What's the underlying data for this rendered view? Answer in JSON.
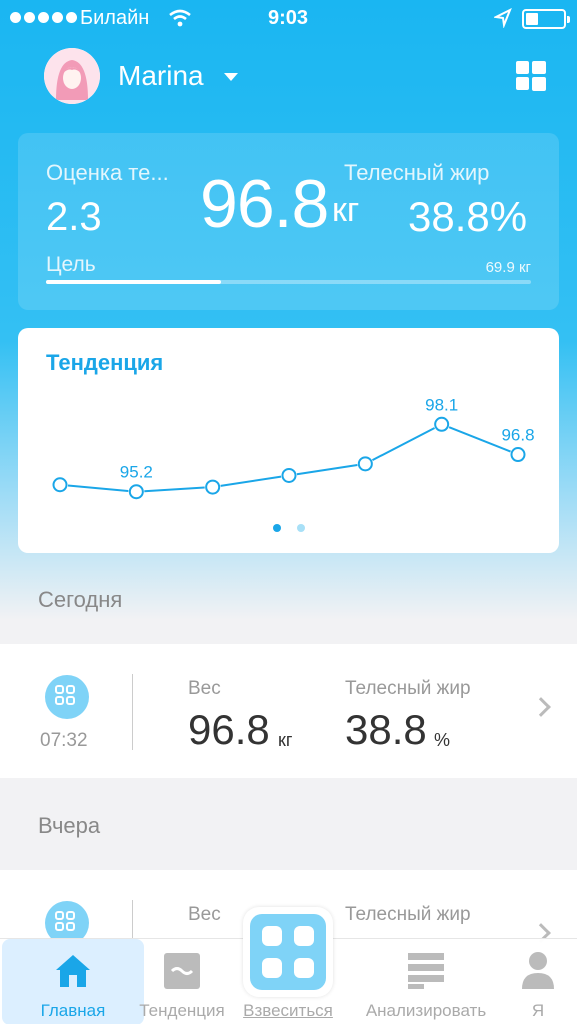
{
  "status_bar": {
    "carrier": "Билайн",
    "time": "9:03"
  },
  "header": {
    "user_name": "Marina"
  },
  "summary": {
    "score_label": "Оценка те...",
    "score_value": "2.3",
    "weight_value": "96.8",
    "weight_unit": "кг",
    "fat_label": "Телесный жир",
    "fat_value": "38.8%",
    "goal_label": "Цель",
    "goal_value": "69.9 кг",
    "goal_progress": 0.36
  },
  "trend": {
    "title": "Тенденция",
    "page_count": 2,
    "active_page": 0,
    "colors": {
      "line": "#1aa6e8",
      "dot_active": "#1aa6e8",
      "dot_inactive": "#a8e0f7"
    }
  },
  "chart_data": {
    "type": "line",
    "x": [
      1,
      2,
      3,
      4,
      5,
      6,
      7
    ],
    "series": [
      {
        "values": [
          95.5,
          95.2,
          95.4,
          95.9,
          96.4,
          98.1,
          96.8
        ]
      }
    ],
    "point_labels": [
      "",
      "95.2",
      "",
      "",
      "",
      "98.1",
      "96.8"
    ],
    "ylim": [
      94.5,
      98.8
    ],
    "grid": false
  },
  "today": {
    "section_title": "Сегодня",
    "time": "07:32",
    "weight_label": "Вес",
    "weight_value": "96.8",
    "weight_unit": "кг",
    "fat_label": "Телесный жир",
    "fat_value": "38.8",
    "fat_unit": "%"
  },
  "yesterday": {
    "section_title": "Вчера",
    "weight_label": "Вес",
    "fat_label": "Телесный жир"
  },
  "tabs": {
    "home": "Главная",
    "trend": "Тенденция",
    "weigh": "Взвеситься",
    "analyze": "Анализировать",
    "me": "Я"
  },
  "icons": [
    "signal-icon",
    "wifi-icon",
    "location-icon",
    "battery-icon",
    "avatar",
    "grid-icon",
    "scale-icon",
    "home-icon",
    "trend-icon",
    "analyze-icon",
    "person-icon",
    "chevron-right-icon"
  ]
}
